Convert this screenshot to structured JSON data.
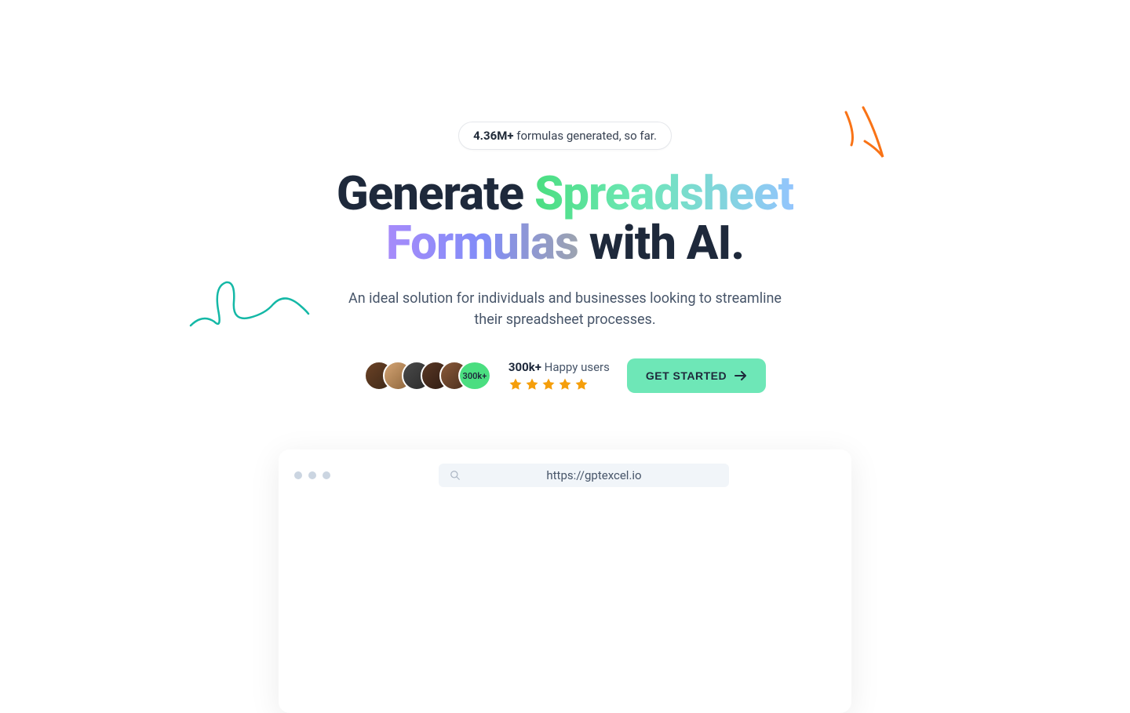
{
  "badge": {
    "count": "4.36M+",
    "suffix": "formulas generated, so far."
  },
  "headline": {
    "part1": "Generate ",
    "spreadsheet": "Spreadsheet",
    "formulas": "Formulas",
    "part2": " with AI."
  },
  "subheadline": "An ideal solution for individuals and businesses looking to streamline their spreadsheet processes.",
  "users": {
    "avatar_count": "300k+",
    "count": "300k+",
    "label": " Happy users"
  },
  "cta": {
    "label": "GET STARTED"
  },
  "browser": {
    "url": "https://gptexcel.io"
  }
}
